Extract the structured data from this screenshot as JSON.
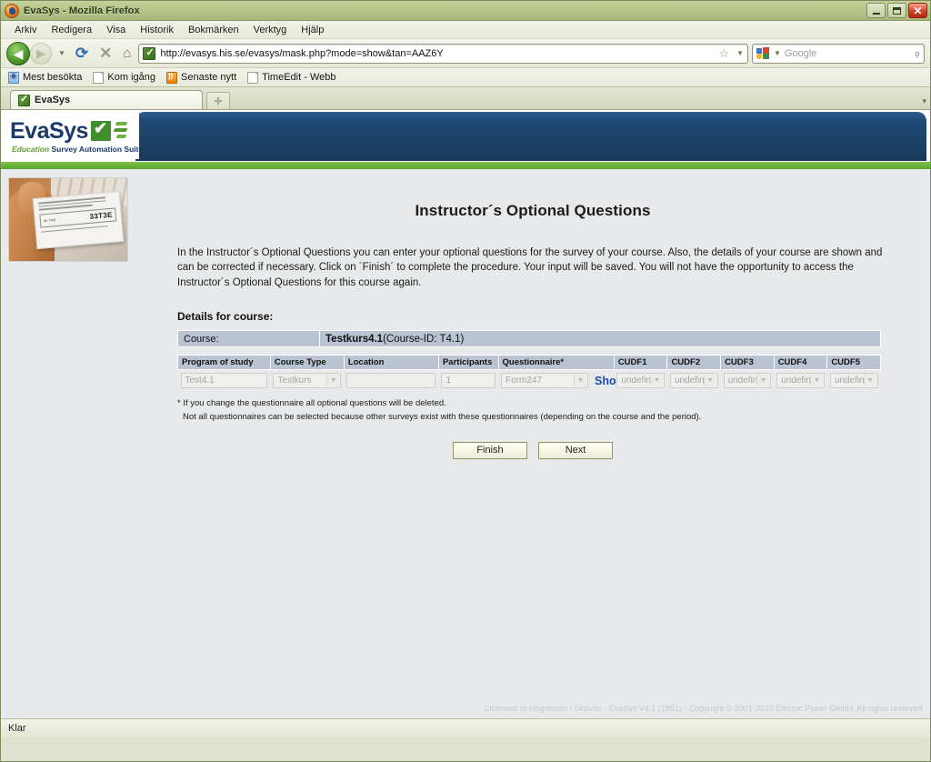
{
  "window": {
    "title": "EvaSys - Mozilla Firefox",
    "minimize_label": "Minimize",
    "maximize_label": "Maximize",
    "close_label": "✕"
  },
  "menu": {
    "items": [
      {
        "label": "Arkiv"
      },
      {
        "label": "Redigera"
      },
      {
        "label": "Visa"
      },
      {
        "label": "Historik"
      },
      {
        "label": "Bokmärken"
      },
      {
        "label": "Verktyg"
      },
      {
        "label": "Hjälp"
      }
    ]
  },
  "toolbar": {
    "back_glyph": "◀",
    "forward_glyph": "▶",
    "history_dropdown_glyph": "▼",
    "reload_glyph": "⟳",
    "stop_glyph": "✕",
    "home_glyph": "⌂",
    "url": "http://evasys.his.se/evasys/mask.php?mode=show&tan=AAZ6Y",
    "star_glyph": "☆",
    "url_dropdown_glyph": "▼",
    "search_placeholder": "Google",
    "search_dropdown_glyph": "▼",
    "magnify_glyph": "⌕"
  },
  "bookmarks": {
    "items": [
      {
        "label": "Mest besökta",
        "icon": "star-icon"
      },
      {
        "label": "Kom igång",
        "icon": "page-icon"
      },
      {
        "label": "Senaste nytt",
        "icon": "rss-icon"
      },
      {
        "label": "TimeEdit - Webb",
        "icon": "page-icon"
      }
    ]
  },
  "tabs": {
    "active": "EvaSys",
    "new_tab_glyph": "✛",
    "list_all_glyph": "▾"
  },
  "banner": {
    "logo_word": "EvaSys",
    "tagline_em": "Education",
    "tagline_rest": " Survey Automation Suite"
  },
  "thumbnail": {
    "name": "tan-card-photo",
    "tan_field_label": "Ihr TAN",
    "tan_code": "33T3E"
  },
  "main": {
    "title": "Instructor´s Optional Questions",
    "intro": "In the Instructor´s Optional Questions you can enter your optional questions for the survey of your course. Also, the details of your course are shown and can be corrected if necessary. Click on ´Finish´ to complete the procedure. Your input will be saved. You will not have the opportunity to access the Instructor´s Optional Questions for this course again.",
    "details_heading": "Details for course:",
    "course_label": "Course:",
    "course_name": "Testkurs4.1",
    "course_id_text": " (Course-ID: T4.1)",
    "columns": [
      "Program of study",
      "Course Type",
      "Location",
      "Participants",
      "Questionnaire*",
      "CUDF1",
      "CUDF2",
      "CUDF3",
      "CUDF4",
      "CUDF5"
    ],
    "values": {
      "program_of_study": "Test4.1",
      "course_type": "Testkurs",
      "location": "",
      "participants": "1",
      "questionnaire": "Form247",
      "show_link": "Show",
      "cudf1": "undefined",
      "cudf2": "undefined",
      "cudf3": "undefined",
      "cudf4": "undefined",
      "cudf5": "undefined"
    },
    "dropdown_glyph": "▼",
    "footnote_line1": "* If you change the questionnaire all optional questions will be deleted.",
    "footnote_line2": "Not all questionnaires can be selected because other surveys exist with these questionnaires (depending on the course and the period).",
    "finish_label": "Finish",
    "next_label": "Next",
    "page_footer": "Licensed to Högskolan i Skövde - EvaSys V4.1 (1851) - Copyright © 2001-2010 Electric Paper GmbH. All rights reserved."
  },
  "statusbar": {
    "text": "Klar"
  },
  "colors": {
    "accent_blue": "#1d4268",
    "accent_green": "#59a32f",
    "table_header": "#b9c3d2",
    "link_blue": "#1d4fa8"
  }
}
